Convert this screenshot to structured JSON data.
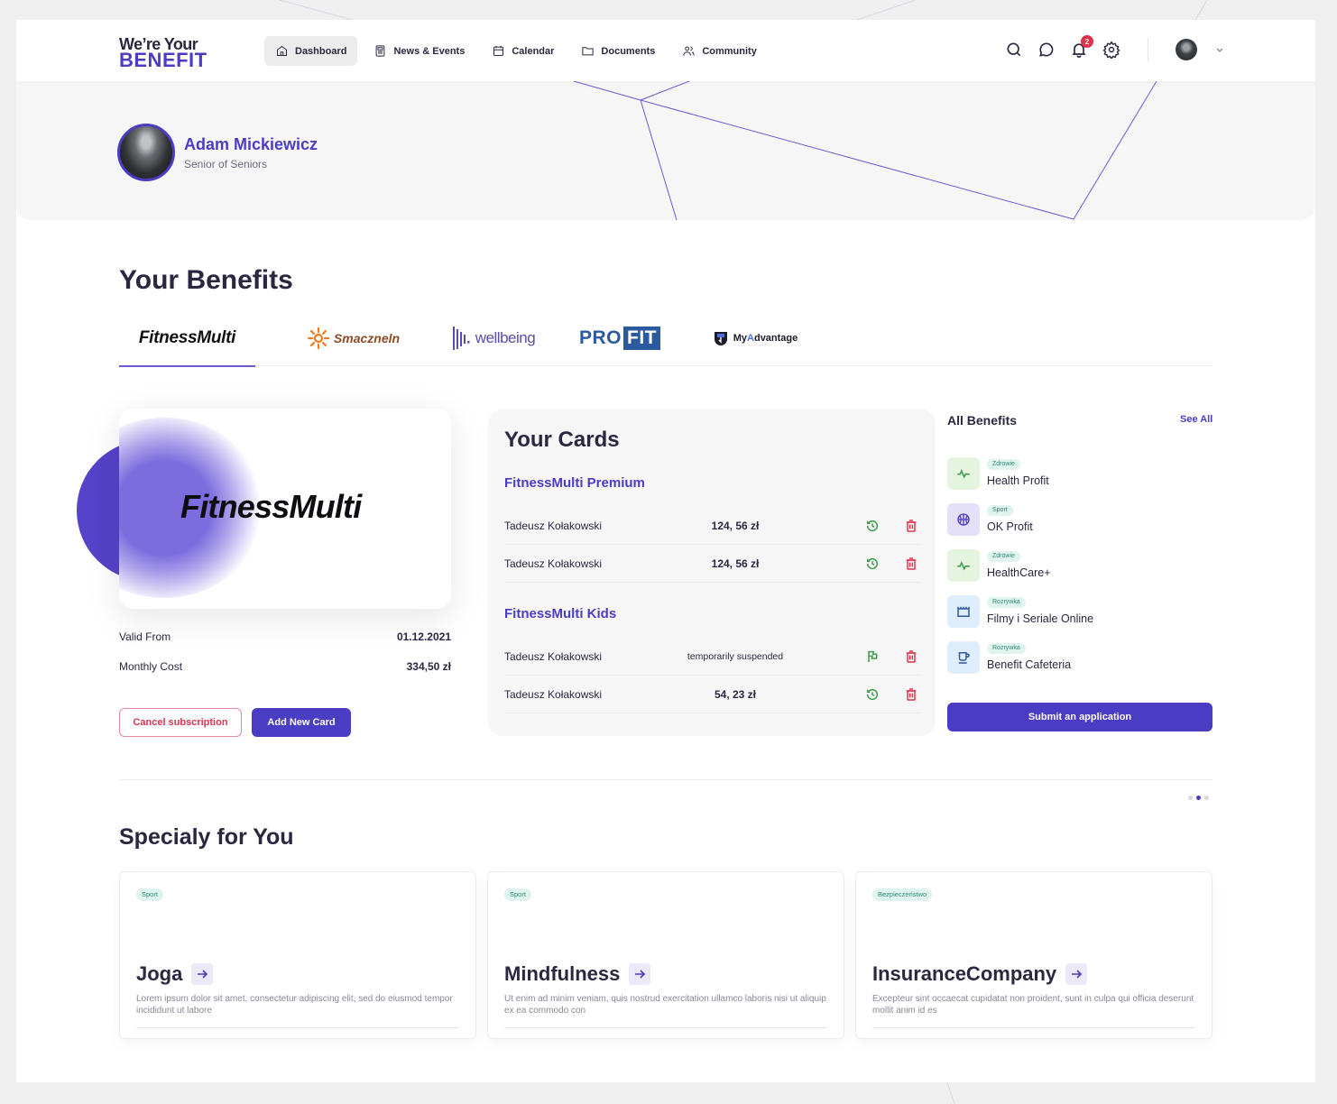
{
  "app": {
    "logo_line1": "We’re Your",
    "logo_line2": "BENEFIT",
    "accent_color": "#4b3cc4"
  },
  "nav": {
    "items": [
      {
        "label": "Dashboard",
        "icon": "home-icon",
        "active": true
      },
      {
        "label": "News & Events",
        "icon": "newspaper-icon",
        "active": false
      },
      {
        "label": "Calendar",
        "icon": "calendar-icon",
        "active": false
      },
      {
        "label": "Documents",
        "icon": "folder-icon",
        "active": false
      },
      {
        "label": "Community",
        "icon": "users-icon",
        "active": false
      }
    ],
    "right_icons": [
      "search-icon",
      "chat-icon",
      "bell-icon",
      "gear-icon"
    ],
    "notification_count": "2"
  },
  "profile": {
    "name": "Adam Mickiewicz",
    "role": "Senior of Seniors"
  },
  "benefits": {
    "heading": "Your Benefits",
    "tabs": [
      {
        "label": "FitnessMulti",
        "active": true
      },
      {
        "label": "Smaczneln",
        "active": false
      },
      {
        "label": "wellbeing",
        "active": false
      },
      {
        "label_a": "PRO",
        "label_b": "FIT",
        "active": false
      },
      {
        "label_a": "My",
        "label_b": "A",
        "label_c": "dvantage",
        "active": false
      }
    ],
    "card_brand": "FitnessMulti",
    "valid_from_label": "Valid From",
    "valid_from_value": "01.12.2021",
    "monthly_cost_label": "Monthly Cost",
    "monthly_cost_value": "334,50 zł",
    "cancel_label": "Cancel subscription",
    "add_card_label": "Add New Card"
  },
  "your_cards": {
    "title": "Your Cards",
    "groups": [
      {
        "title": "FitnessMulti Premium",
        "rows": [
          {
            "name": "Tadeusz Kołakowski",
            "value": "124, 56 zł",
            "action": "history-icon"
          },
          {
            "name": "Tadeusz Kołakowski",
            "value": "124, 56 zł",
            "action": "history-icon"
          }
        ]
      },
      {
        "title": "FitnessMulti Kids",
        "rows": [
          {
            "name": "Tadeusz Kołakowski",
            "value": "temporarily suspended",
            "action": "flag-icon"
          },
          {
            "name": "Tadeusz Kołakowski",
            "value": "54, 23 zł",
            "action": "history-icon"
          }
        ]
      }
    ]
  },
  "all_benefits": {
    "title": "All Benefits",
    "see_all": "See All",
    "items": [
      {
        "tag": "Zdrowie",
        "name": "Health Profit",
        "icon": "pulse-icon"
      },
      {
        "tag": "Sport",
        "name": "OK Profit",
        "icon": "basketball-icon"
      },
      {
        "tag": "Zdrowie",
        "name": "HealthCare+",
        "icon": "pulse-icon"
      },
      {
        "tag": "Rozrywka",
        "name": "Filmy i Seriale Online",
        "icon": "clapper-icon"
      },
      {
        "tag": "Rozrywka",
        "name": "Benefit Cafeteria",
        "icon": "cup-icon"
      }
    ],
    "submit_label": "Submit an application"
  },
  "carousel": {
    "pages": 3,
    "current": 2
  },
  "special": {
    "heading": "Specialy for You",
    "cards": [
      {
        "tag": "Sport",
        "title": "Joga",
        "desc": "Lorem ipsum dolor sit amet, consectetur adipiscing elit, sed do eiusmod tempor incididunt ut labore"
      },
      {
        "tag": "Sport",
        "title": "Mindfulness",
        "desc": "Ut enim ad minim veniam, quis nostrud exercitation ullamco laboris nisi ut aliquip ex ea commodo con"
      },
      {
        "tag": "Bezpieczeństwo",
        "title": "InsuranceCompany",
        "desc": "Excepteur sint occaecat cupidatat non proident, sunt in culpa qui officia deserunt mollit anim id es"
      }
    ]
  }
}
